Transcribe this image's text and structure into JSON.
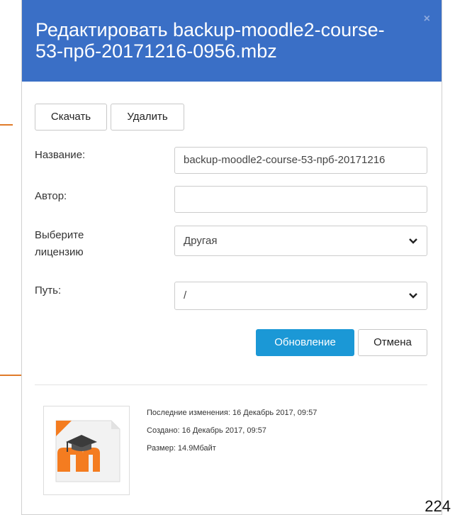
{
  "dialog": {
    "title": "Редактировать backup-moodle2-course-53-прб-20171216-0956.mbz",
    "close_symbol": "×"
  },
  "actions": {
    "download_label": "Скачать",
    "delete_label": "Удалить"
  },
  "form": {
    "name_label": "Название:",
    "name_value": "backup-moodle2-course-53-прб-20171216",
    "author_label": "Автор:",
    "author_value": "",
    "license_label": "Выберите лицензию",
    "license_value": "Другая",
    "path_label": "Путь:",
    "path_value": "/"
  },
  "buttons": {
    "update_label": "Обновление",
    "cancel_label": "Отмена"
  },
  "file_info": {
    "modified": "Последние изменения:  16 Декабрь 2017, 09:57",
    "created": "Создано:  16 Декабрь 2017, 09:57",
    "size": "Размер:  14.9Мбайт",
    "icon": "moodle-file-icon"
  },
  "page_number": "224",
  "colors": {
    "header": "#3a6fc6",
    "primary_button": "#1b98d6",
    "annotation_arrow": "#e07b2a"
  }
}
